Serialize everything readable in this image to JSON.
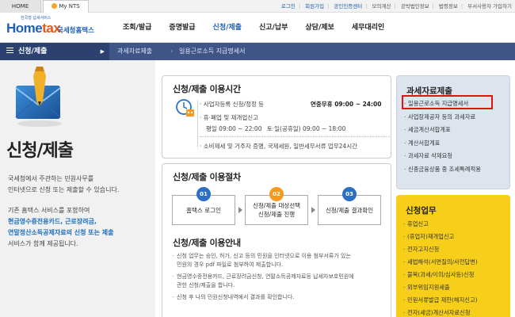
{
  "topbar": {
    "home_tab": "HOME",
    "mynts_tab": "My NTS",
    "links": [
      "로그인",
      "회원가입",
      "공인인증센터",
      "모의계산",
      "공박법인정보",
      "법령정보",
      "부서사용자 가입하기"
    ]
  },
  "header": {
    "logo_sub": "한국형 납세서비스",
    "logo_main_a": "Home",
    "logo_main_b": "tax",
    "logo_kor": "국세청홈택스",
    "nav": [
      "조회/발급",
      "증명발급",
      "신청/제출",
      "신고/납부",
      "상담/제보",
      "세무대리인"
    ],
    "active_nav": "신청/제출"
  },
  "location": {
    "menu_label": "신청/제출",
    "crumb1": "과세자료제출",
    "crumb2": "일용근로소득 지급명세서"
  },
  "left": {
    "title": "신청/제출",
    "desc1_line1": "국세청에서 주관하는 민원사무를",
    "desc1_line2": "인터넷으로 신청 또는 제출할 수 있습니다.",
    "desc2_line1": "기존 홈택스 서비스를 포함하여",
    "desc2_line2": "현금영수증전용카드, 근로장려금,",
    "desc2_line3a": "연말정산소득공제자료의 신청 또는 제출",
    "desc2_line4": "서비스가 함께 제공됩니다."
  },
  "hours": {
    "title": "신청/제출 이용시간",
    "row1_label": "사업자등록 신청/정정 등",
    "row1_value": "연중무휴 09:00 ~ 24:00",
    "row2_label": "휴·폐업 및 재개업신고",
    "row3_weekday": "평일 09:00 ~ 22:00",
    "row3_weekend": "토·일(공휴일) 09:00 ~ 18:00",
    "row4_label": "소비제세 및 거주자 증명, 국제세원, 일반세무서류 업무24시간"
  },
  "procedure": {
    "title": "신청/제출 이용절차",
    "steps": [
      {
        "num": "01",
        "label": "홈택스 로그인",
        "color": "#2c70c4"
      },
      {
        "num": "02",
        "label_line1": "신청/제출 대상선택",
        "label_line2": "신청/제출 진행",
        "color": "#f59a21"
      },
      {
        "num": "03",
        "label": "신청/제출 결과확인",
        "color": "#2c70c4"
      }
    ]
  },
  "guide": {
    "title": "신청/제출 이용안내",
    "notes": [
      "신청 업무는 승인, 허가, 신고 등의 민원을 인터넷으로 이용 첨부서류가 있는",
      "민원의 경우 pdf 파일로 첨부하여 제출합니다.",
      "현금영수증전용카드, 근로장려금신청, 연말소득공제자료등 납세자보호민원에",
      "관한 신청/제출을 합니다.",
      "신청 후 나의 민원신청내역에서 결과를 확인합니다."
    ]
  },
  "sidebar_tax": {
    "title": "과세자료제출",
    "items": [
      "일용근로소득 지급명세서",
      "사업장제공자 등의 과세자료",
      "세금계산서합계표",
      "계산서합계표",
      "과세자료 삭제요청",
      "신종금융상품 중 조세특례적용"
    ],
    "highlighted": "일용근로소득 지급명세서",
    "highlight_color": "#e01212"
  },
  "sidebar_apply": {
    "title": "신청업무",
    "items": [
      "휴업신고",
      "(휴업자)재개업신고",
      "전자고지신청",
      "세법해석(서면질의/사전답변)",
      "불복(과세/이의/심사등)신청",
      "외부위임지원세출",
      "민원서류발급 제한(해지신고)",
      "전자(세금)계산서자료신청"
    ]
  }
}
